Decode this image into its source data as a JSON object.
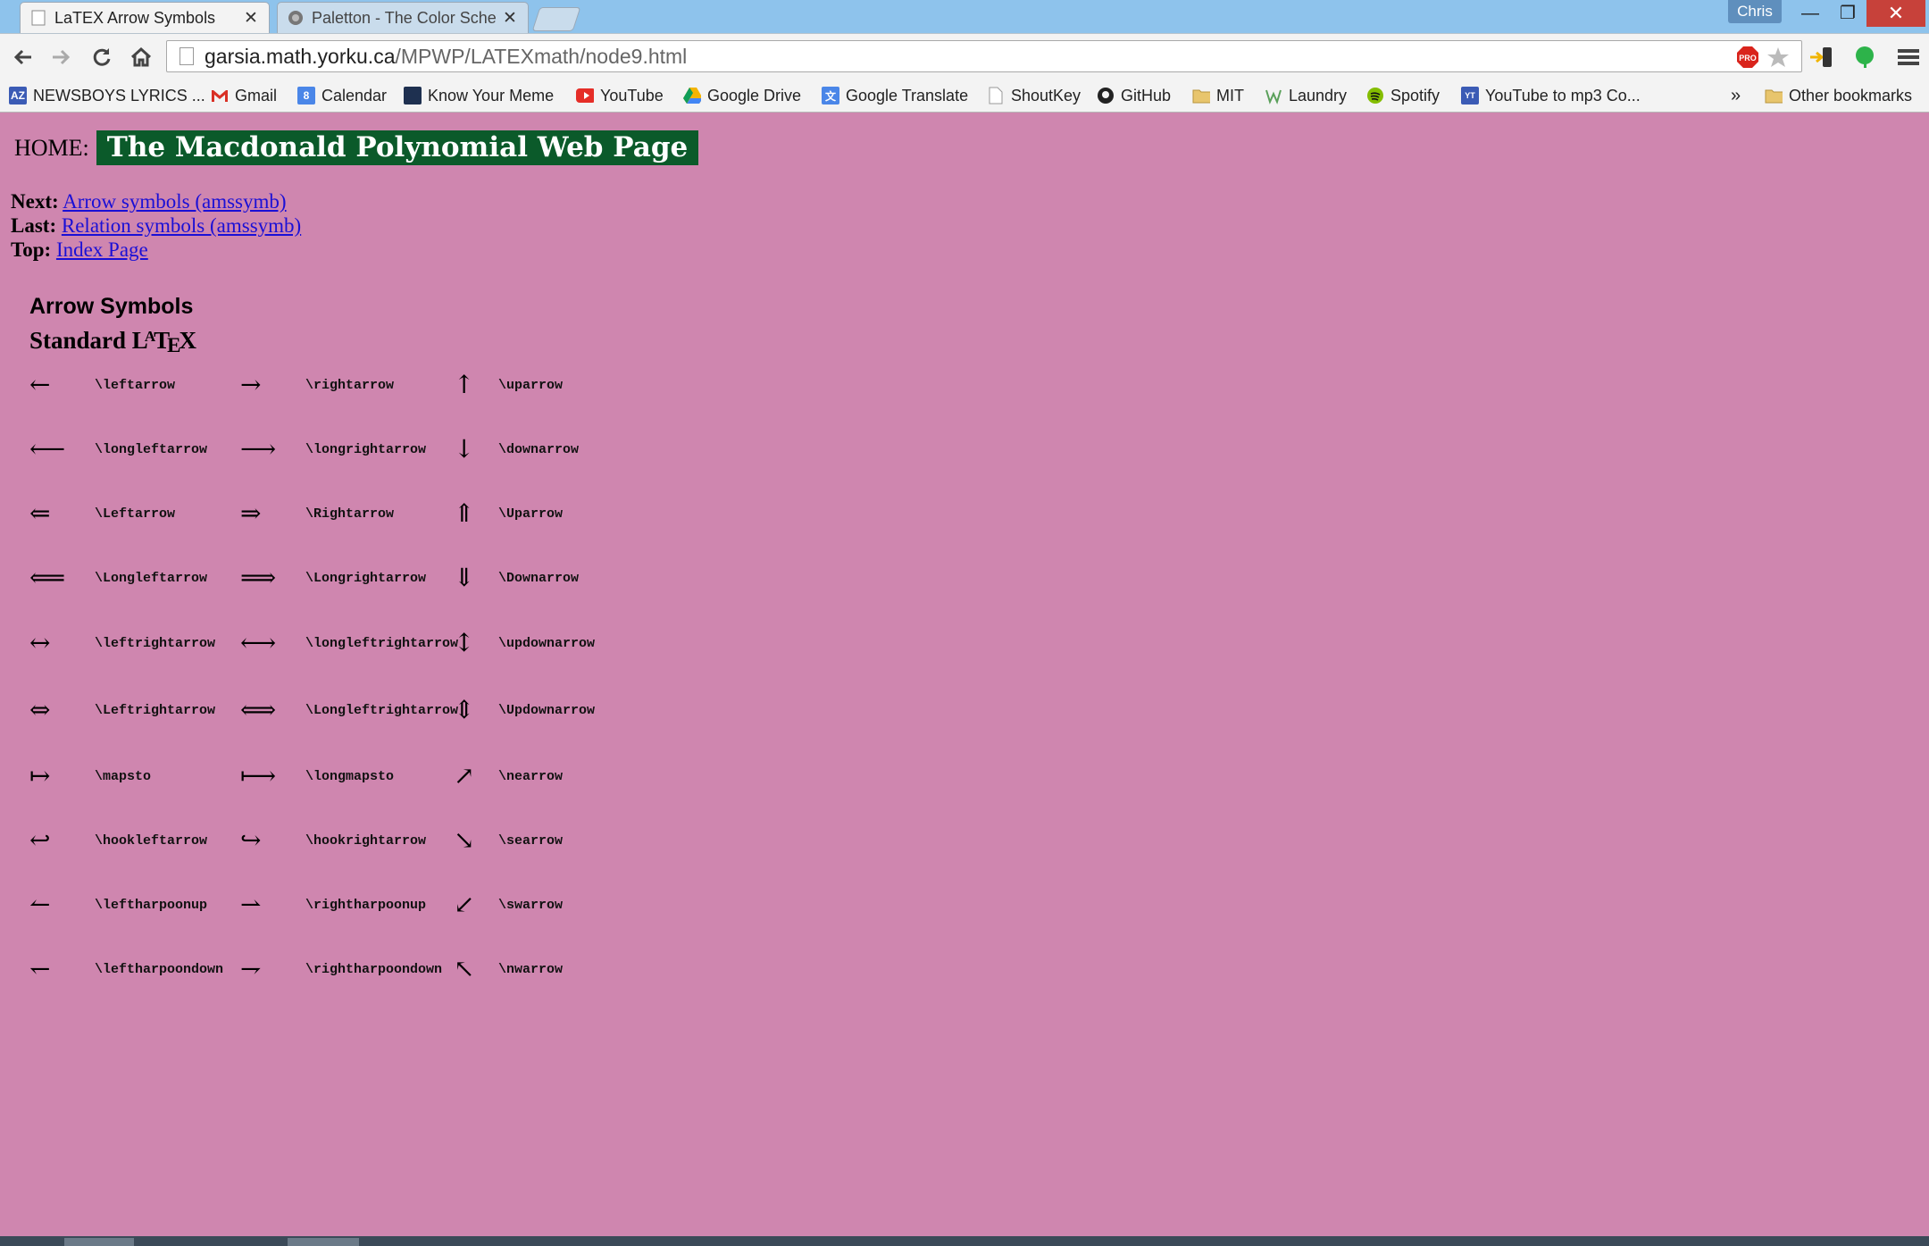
{
  "browser": {
    "tabs": [
      {
        "title": "LaTEX Arrow Symbols",
        "active": true
      },
      {
        "title": "Paletton - The Color Scheme Designer",
        "active": false
      }
    ],
    "profile_name": "Chris",
    "window_controls": {
      "minimize": "—",
      "maximize": "❐",
      "close": "✕"
    },
    "url": {
      "host": "garsia.math.yorku.ca",
      "path": "/MPWP/LATEXmath/node9.html"
    },
    "bookmarks": [
      {
        "label": "NEWSBOYS LYRICS ...",
        "icon": "az-icon",
        "color": "#3b5bb5"
      },
      {
        "label": "Gmail",
        "icon": "gmail-icon",
        "color": "#d93025"
      },
      {
        "label": "Calendar",
        "icon": "calendar-icon",
        "color": "#4a86e8"
      },
      {
        "label": "Know Your Meme",
        "icon": "kym-icon",
        "color": "#1e3050"
      },
      {
        "label": "YouTube",
        "icon": "youtube-icon",
        "color": "#e52d27"
      },
      {
        "label": "Google Drive",
        "icon": "drive-icon",
        "color": "#f4b400"
      },
      {
        "label": "Google Translate",
        "icon": "translate-icon",
        "color": "#4a86e8"
      },
      {
        "label": "ShoutKey",
        "icon": "page-icon",
        "color": "#dddddd"
      },
      {
        "label": "GitHub",
        "icon": "github-icon",
        "color": "#222222"
      },
      {
        "label": "MIT",
        "icon": "folder-icon",
        "color": "#e8c56d"
      },
      {
        "label": "Laundry",
        "icon": "laundry-icon",
        "color": "#5aa05a"
      },
      {
        "label": "Spotify",
        "icon": "spotify-icon",
        "color": "#84bd00"
      },
      {
        "label": "YouTube to mp3 Co...",
        "icon": "yt-mp3-icon",
        "color": "#3b5bb5"
      }
    ],
    "overflow": "»",
    "other_bookmarks": "Other bookmarks"
  },
  "page": {
    "home_label": "HOME:",
    "home_banner": "The Macdonald Polynomial Web Page",
    "nav": [
      {
        "label": "Next:",
        "link": "Arrow symbols (amssymb)"
      },
      {
        "label": "Last:",
        "link": "Relation symbols (amssymb)"
      },
      {
        "label": "Top:",
        "link": "Index Page"
      }
    ],
    "section_heading": "Arrow Symbols",
    "sub_heading": {
      "pre": "Standard L",
      "a": "A",
      "t": "T",
      "e": "E",
      "x": "X"
    },
    "rows": [
      [
        {
          "glyph": "←",
          "cmd": "\\leftarrow"
        },
        {
          "glyph": "→",
          "cmd": "\\rightarrow"
        },
        {
          "glyph": "↑",
          "cmd": "\\uparrow"
        }
      ],
      [
        {
          "glyph": "⟵",
          "cmd": "\\longleftarrow"
        },
        {
          "glyph": "⟶",
          "cmd": "\\longrightarrow"
        },
        {
          "glyph": "↓",
          "cmd": "\\downarrow"
        }
      ],
      [
        {
          "glyph": "⇐",
          "cmd": "\\Leftarrow"
        },
        {
          "glyph": "⇒",
          "cmd": "\\Rightarrow"
        },
        {
          "glyph": "⇑",
          "cmd": "\\Uparrow"
        }
      ],
      [
        {
          "glyph": "⟸",
          "cmd": "\\Longleftarrow"
        },
        {
          "glyph": "⟹",
          "cmd": "\\Longrightarrow"
        },
        {
          "glyph": "⇓",
          "cmd": "\\Downarrow"
        }
      ],
      [
        {
          "glyph": "↔",
          "cmd": "\\leftrightarrow"
        },
        {
          "glyph": "⟷",
          "cmd": "\\longleftrightarrow"
        },
        {
          "glyph": "↕",
          "cmd": "\\updownarrow"
        }
      ],
      [
        {
          "glyph": "⇔",
          "cmd": "\\Leftrightarrow"
        },
        {
          "glyph": "⟺",
          "cmd": "\\Longleftrightarrow"
        },
        {
          "glyph": "⇕",
          "cmd": "\\Updownarrow"
        }
      ],
      [
        {
          "glyph": "↦",
          "cmd": "\\mapsto"
        },
        {
          "glyph": "⟼",
          "cmd": "\\longmapsto"
        },
        {
          "glyph": "↗",
          "cmd": "\\nearrow"
        }
      ],
      [
        {
          "glyph": "↩",
          "cmd": "\\hookleftarrow"
        },
        {
          "glyph": "↪",
          "cmd": "\\hookrightarrow"
        },
        {
          "glyph": "↘",
          "cmd": "\\searrow"
        }
      ],
      [
        {
          "glyph": "↼",
          "cmd": "\\leftharpoonup"
        },
        {
          "glyph": "⇀",
          "cmd": "\\rightharpoonup"
        },
        {
          "glyph": "↙",
          "cmd": "\\swarrow"
        }
      ],
      [
        {
          "glyph": "↽",
          "cmd": "\\leftharpoondown"
        },
        {
          "glyph": "⇁",
          "cmd": "\\rightharpoondown"
        },
        {
          "glyph": "↖",
          "cmd": "\\nwarrow"
        }
      ]
    ]
  },
  "colors": {
    "page_background": "#cf86af",
    "banner_background": "#0b5a2a",
    "link": "#1a0fd6",
    "tab_strip": "#8ec3ec"
  }
}
